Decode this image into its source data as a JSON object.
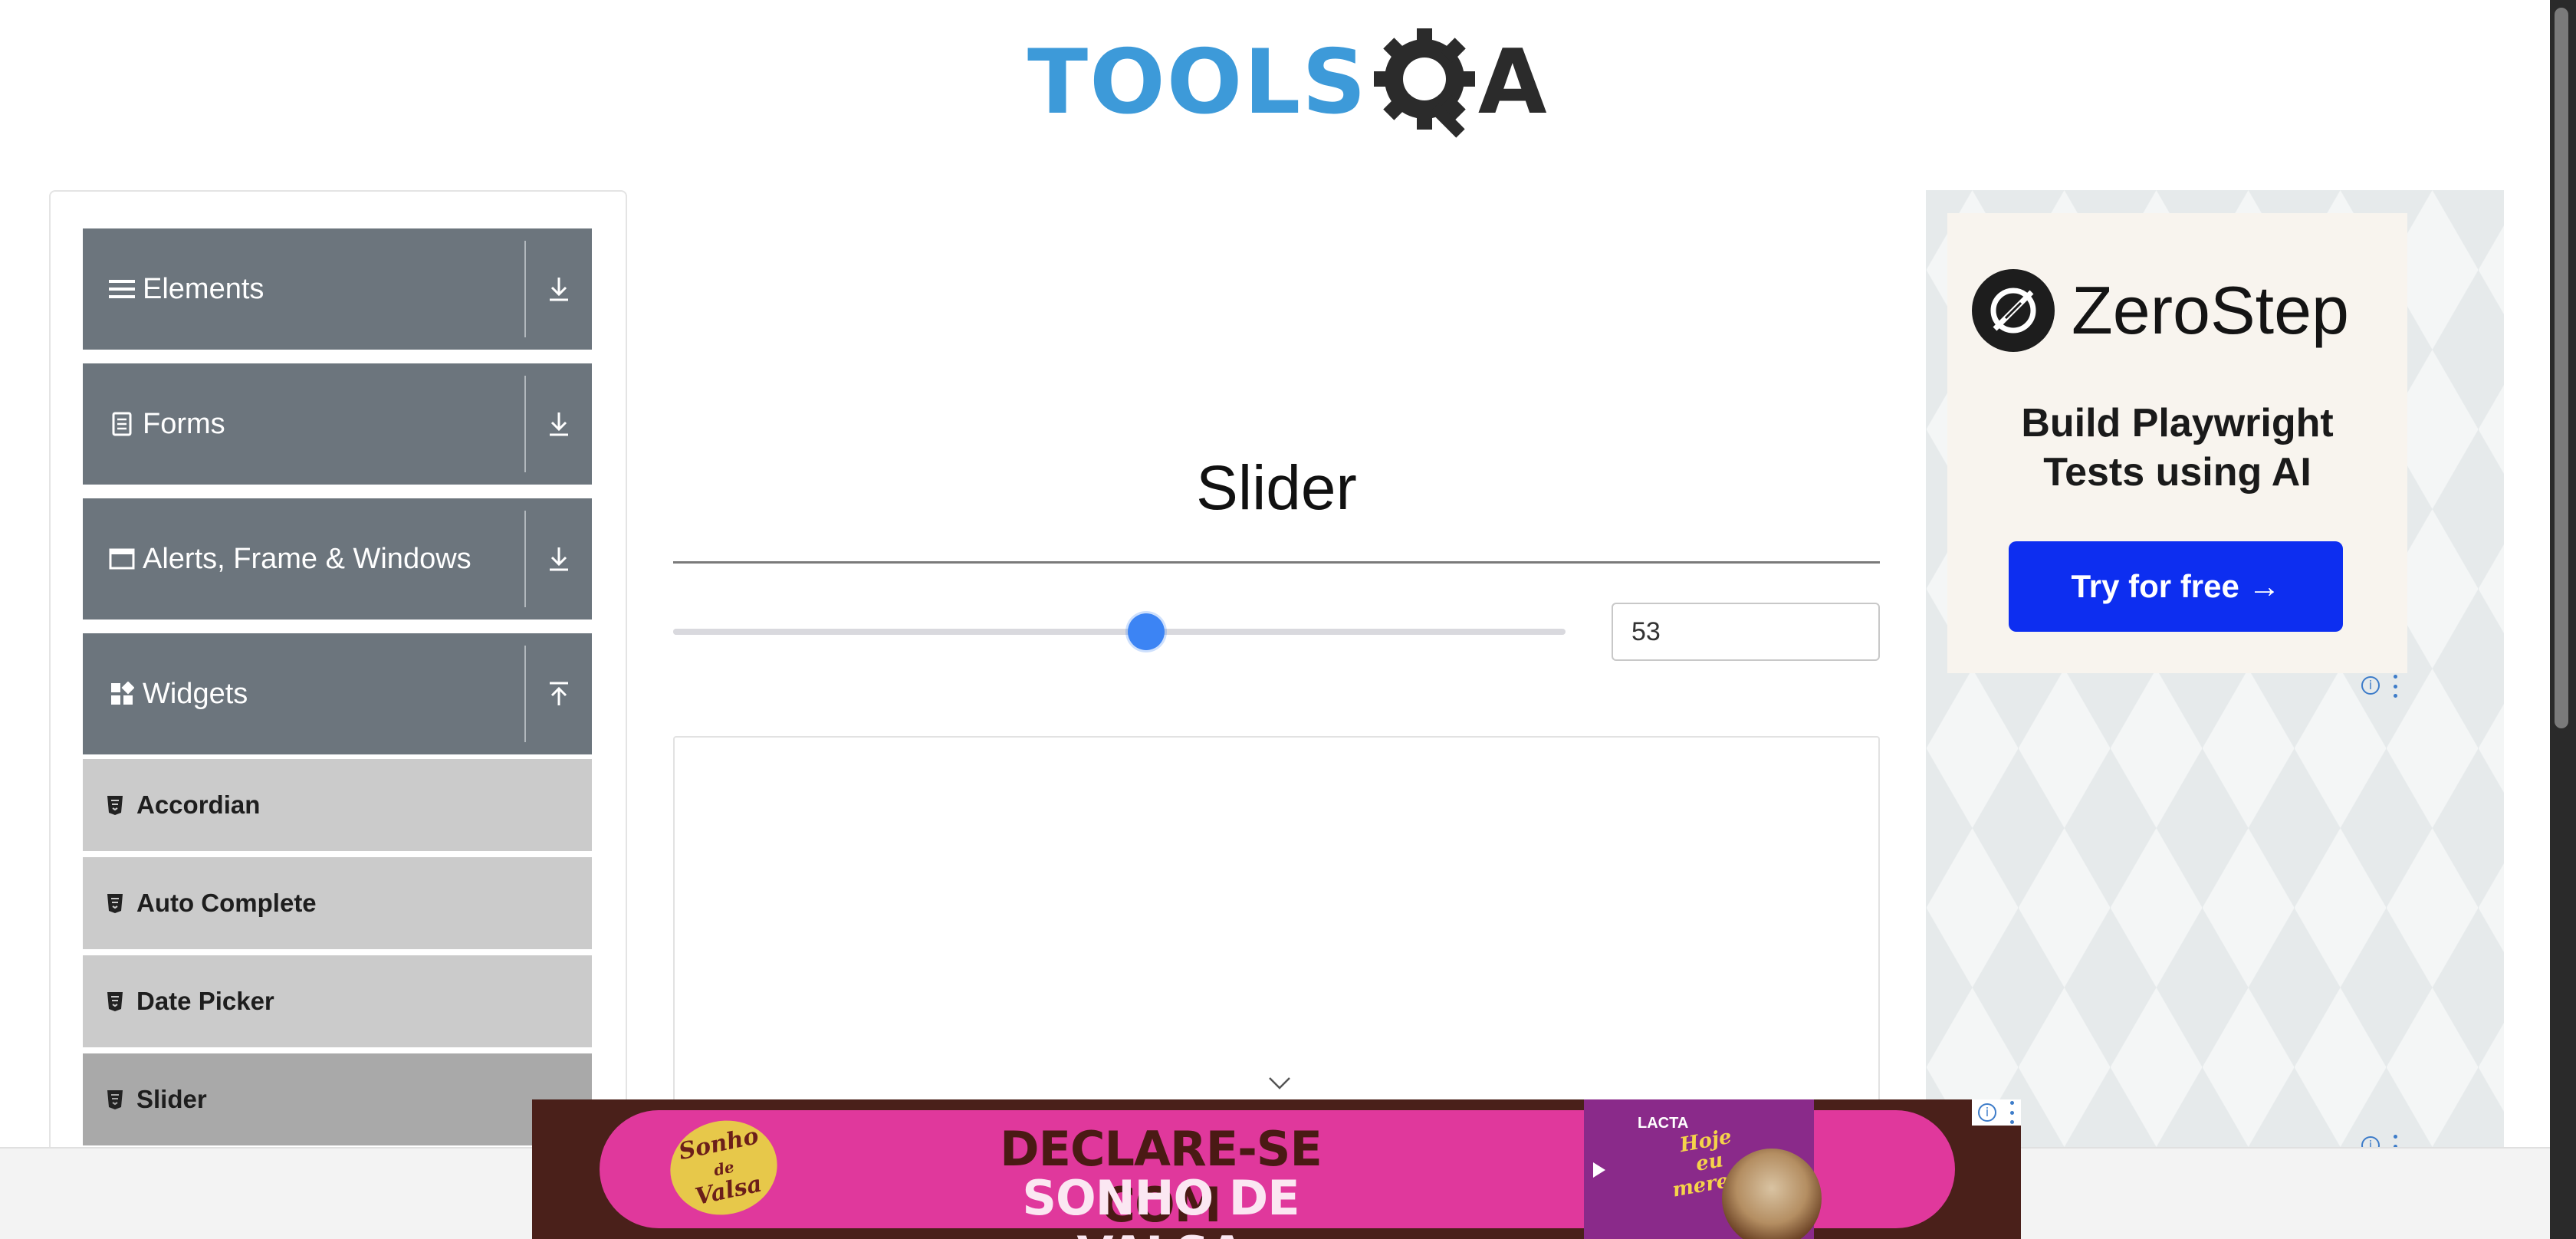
{
  "header": {
    "logo_text": "TOOLS",
    "logo_suffix": "A"
  },
  "sidebar": {
    "groups": [
      {
        "label": "Elements",
        "icon": "hamburger-icon",
        "state": "collapsed"
      },
      {
        "label": "Forms",
        "icon": "document-icon",
        "state": "collapsed"
      },
      {
        "label": "Alerts, Frame & Windows",
        "icon": "window-icon",
        "state": "collapsed"
      },
      {
        "label": "Widgets",
        "icon": "widgets-icon",
        "state": "expanded"
      }
    ],
    "widget_items": [
      {
        "label": "Accordian",
        "active": false
      },
      {
        "label": "Auto Complete",
        "active": false
      },
      {
        "label": "Date Picker",
        "active": false
      },
      {
        "label": "Slider",
        "active": true
      }
    ]
  },
  "main": {
    "title": "Slider",
    "slider": {
      "value": "53",
      "min": 0,
      "max": 100,
      "level": 53
    }
  },
  "right_ad": {
    "brand": "ZeroStep",
    "headline_line1": "Build Playwright",
    "headline_line2": "Tests using AI",
    "cta_label": "Try for free →",
    "info_glyph": "i"
  },
  "banner_ad": {
    "logo_line1": "Sonho",
    "logo_line2": "de",
    "logo_line3": "Valsa",
    "line1": "DECLARE-SE COM",
    "line2": "SONHO DE VALSA",
    "product_brand": "LACTA",
    "product_tag_line1": "Hoje",
    "product_tag_line2": "eu",
    "product_tag_line3": "mereço",
    "info_glyph": "i"
  },
  "colors": {
    "sidebar_group_bg": "#6c757d",
    "menu_item_bg": "#cbcbcb",
    "menu_item_active_bg": "#a9a9a9",
    "slider_thumb": "#3c84f4",
    "logo_blue": "#3d9ad9",
    "ad_cta": "#0d2ef0",
    "banner_pink": "#e0389c"
  }
}
